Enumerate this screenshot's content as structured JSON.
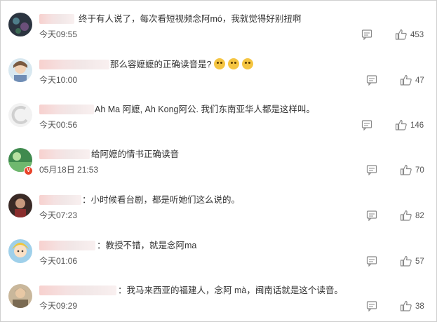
{
  "comments": [
    {
      "text": "终于有人说了，每次看短视频念阿mó，我就觉得好别扭啊",
      "time": "今天09:55",
      "likes": "453",
      "icons": {
        "reply": "comment-icon",
        "like": "thumbs-up-icon"
      }
    },
    {
      "text": "那么容嬷嬷的正确读音是?",
      "emoji_count": 3,
      "time": "今天10:00",
      "likes": "47"
    },
    {
      "text": "Ah Ma 阿嬷, Ah Kong阿公. 我们东南亚华人都是这样叫。",
      "time": "今天00:56",
      "likes": "146"
    },
    {
      "text": "给阿嬷的情书正确读音",
      "time": "05月18日 21:53",
      "likes": "70",
      "verified_badge": "V"
    },
    {
      "text": "：小时候看台剧，都是听她们这么说的。",
      "time": "今天07:23",
      "likes": "82"
    },
    {
      "text": "：教授不错，就是念阿ma",
      "time": "今天01:06",
      "likes": "57"
    },
    {
      "text": "：我马来西亚的福建人，念阿 mà，闽南话就是这个读音。",
      "time": "今天09:29",
      "likes": "38"
    }
  ],
  "colors": {
    "text": "#333333",
    "meta": "#555555",
    "badge": "#e8432a",
    "icon": "#888888"
  }
}
